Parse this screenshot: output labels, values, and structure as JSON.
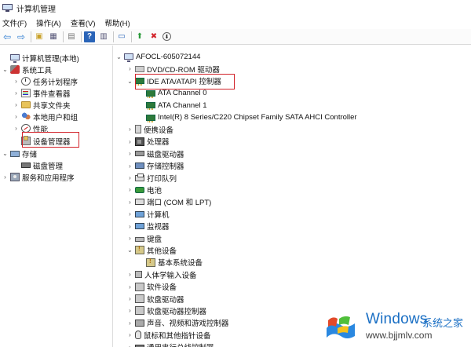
{
  "window": {
    "title": "计算机管理"
  },
  "menu": {
    "items": [
      "文件(F)",
      "操作(A)",
      "查看(V)",
      "帮助(H)"
    ]
  },
  "toolbar": {
    "buttons": [
      {
        "name": "back-icon",
        "glyph": "⇦"
      },
      {
        "name": "forward-icon",
        "glyph": "⇨"
      },
      {
        "name": "up-folder-icon",
        "glyph": "▣"
      },
      {
        "name": "show-tree-icon",
        "glyph": "▦"
      },
      {
        "name": "properties-icon",
        "glyph": "▤"
      },
      {
        "name": "help-icon",
        "glyph": "?"
      },
      {
        "name": "action-pane-icon",
        "glyph": "▥"
      },
      {
        "name": "monitor-icon",
        "glyph": "▭"
      },
      {
        "name": "update-driver-icon",
        "glyph": "⬆"
      },
      {
        "name": "uninstall-icon",
        "glyph": "✖"
      },
      {
        "name": "scan-hardware-icon",
        "glyph": "⬇"
      }
    ]
  },
  "left_tree": [
    {
      "label": "计算机管理(本地)",
      "icon": "comp",
      "expander": "",
      "name": "tree-root"
    },
    {
      "label": "系统工具",
      "icon": "tool",
      "expander": "⌄",
      "name": "tree-system-tools"
    },
    {
      "label": "任务计划程序",
      "icon": "clock",
      "expander": "›",
      "name": "tree-task-scheduler"
    },
    {
      "label": "事件查看器",
      "icon": "log",
      "expander": "›",
      "name": "tree-event-viewer"
    },
    {
      "label": "共享文件夹",
      "icon": "folder",
      "expander": "›",
      "name": "tree-shared-folders"
    },
    {
      "label": "本地用户和组",
      "icon": "users",
      "expander": "›",
      "name": "tree-local-users"
    },
    {
      "label": "性能",
      "icon": "perf",
      "expander": "›",
      "name": "tree-performance"
    },
    {
      "label": "设备管理器",
      "icon": "devmgr",
      "expander": "",
      "name": "tree-device-manager"
    },
    {
      "label": "存储",
      "icon": "storage",
      "expander": "⌄",
      "name": "tree-storage"
    },
    {
      "label": "磁盘管理",
      "icon": "disk",
      "expander": "",
      "name": "tree-disk-management"
    },
    {
      "label": "服务和应用程序",
      "icon": "service",
      "expander": "›",
      "name": "tree-services-apps"
    }
  ],
  "device_tree": [
    {
      "label": "AFOCL-605072144",
      "icon": "comp",
      "expander": "⌄",
      "name": "device-root"
    },
    {
      "label": "DVD/CD-ROM 驱动器",
      "icon": "dvd",
      "expander": "›",
      "name": "device-dvd"
    },
    {
      "label": "IDE ATA/ATAPI 控制器",
      "icon": "ide",
      "expander": "⌄",
      "name": "device-ide-controller"
    },
    {
      "label": "ATA Channel 0",
      "icon": "ide",
      "expander": "",
      "name": "device-ata-channel-0"
    },
    {
      "label": "ATA Channel 1",
      "icon": "ide",
      "expander": "",
      "name": "device-ata-channel-1"
    },
    {
      "label": "Intel(R) 8 Series/C220 Chipset Family SATA AHCI Controller",
      "icon": "ide",
      "expander": "",
      "name": "device-sata-ahci"
    },
    {
      "label": "便携设备",
      "icon": "portable",
      "expander": "›",
      "name": "device-portable"
    },
    {
      "label": "处理器",
      "icon": "cpu",
      "expander": "›",
      "name": "device-processor"
    },
    {
      "label": "磁盘驱动器",
      "icon": "hdd",
      "expander": "›",
      "name": "device-disk-drives"
    },
    {
      "label": "存储控制器",
      "icon": "storctl",
      "expander": "›",
      "name": "device-storage-controllers"
    },
    {
      "label": "打印队列",
      "icon": "printq",
      "expander": "›",
      "name": "device-print-queues"
    },
    {
      "label": "电池",
      "icon": "battery",
      "expander": "›",
      "name": "device-battery"
    },
    {
      "label": "端口 (COM 和 LPT)",
      "icon": "port",
      "expander": "›",
      "name": "device-ports"
    },
    {
      "label": "计算机",
      "icon": "monitor",
      "expander": "›",
      "name": "device-computer"
    },
    {
      "label": "监视器",
      "icon": "monitor",
      "expander": "›",
      "name": "device-monitors"
    },
    {
      "label": "键盘",
      "icon": "keyboard",
      "expander": "›",
      "name": "device-keyboards"
    },
    {
      "label": "其他设备",
      "icon": "other",
      "expander": "⌄",
      "name": "device-other"
    },
    {
      "label": "基本系统设备",
      "icon": "other",
      "expander": "",
      "name": "device-base-system"
    },
    {
      "label": "人体学输入设备",
      "icon": "hid",
      "expander": "›",
      "name": "device-hid"
    },
    {
      "label": "软件设备",
      "icon": "soft",
      "expander": "›",
      "name": "device-software"
    },
    {
      "label": "软盘驱动器",
      "icon": "soft",
      "expander": "›",
      "name": "device-floppy-drives"
    },
    {
      "label": "软盘驱动器控制器",
      "icon": "soft",
      "expander": "›",
      "name": "device-floppy-controllers"
    },
    {
      "label": "声音、视频和游戏控制器",
      "icon": "sound",
      "expander": "›",
      "name": "device-sound"
    },
    {
      "label": "鼠标和其他指针设备",
      "icon": "mouse",
      "expander": "›",
      "name": "device-mouse"
    },
    {
      "label": "通用串行总线控制器",
      "icon": "usb",
      "expander": "›",
      "name": "device-usb"
    }
  ],
  "watermark": {
    "brand": "Windows",
    "cn": "系统之家",
    "url": "www.bjjmlv.com"
  },
  "colors": {
    "highlight_box": "#d2232a",
    "brand_blue": "#1a6fc4"
  }
}
